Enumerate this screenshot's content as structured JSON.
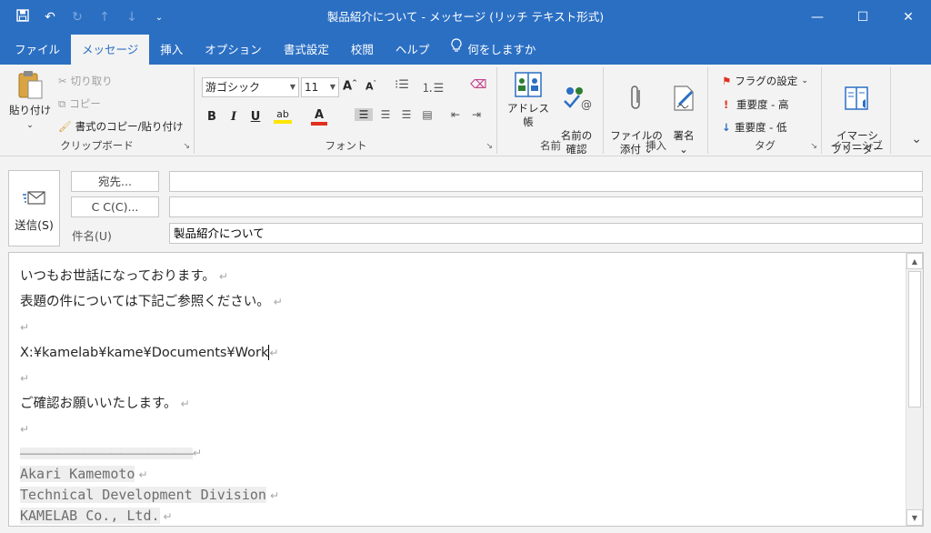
{
  "window": {
    "title": "製品紹介について - メッセージ (リッチ テキスト形式)",
    "qat_icons": [
      "save-icon",
      "undo-icon",
      "redo-icon",
      "up-arrow-icon",
      "down-arrow-icon",
      "customize-qat-icon"
    ],
    "controls": {
      "minimize": "—",
      "maximize": "☐",
      "close": "✕"
    }
  },
  "tabs": [
    "ファイル",
    "メッセージ",
    "挿入",
    "オプション",
    "書式設定",
    "校閲",
    "ヘルプ"
  ],
  "active_tab": "メッセージ",
  "tell_me": "何をしますか",
  "ribbon": {
    "clipboard": {
      "paste": "貼り付け",
      "cut": "切り取り",
      "copy": "コピー",
      "format_painter": "書式のコピー/貼り付け",
      "label": "クリップボード"
    },
    "font": {
      "font_name": "游ゴシック",
      "font_size": "11",
      "grow": "A",
      "shrink": "A",
      "bold": "B",
      "italic": "I",
      "underline": "U",
      "color_a": "A",
      "label": "フォント"
    },
    "names": {
      "address_book": "アドレス帳",
      "check_names": "名前の\n確認",
      "label": "名前"
    },
    "include": {
      "attach": "ファイルの\n添付 ⌄",
      "signature": "署名\n⌄",
      "label": "挿入"
    },
    "tags": {
      "follow_up": "フラグの設定",
      "high": "重要度 - 高",
      "low": "重要度 - 低",
      "label": "タグ"
    },
    "immersive": {
      "reader": "イマーシ\nブリーダー",
      "label": "イマーシブ"
    }
  },
  "header": {
    "send": "送信(S)",
    "to_button": "宛先...",
    "cc_button": "C C(C)...",
    "subject_label": "件名(U)",
    "to_value": "",
    "cc_value": "",
    "subject_value": "製品紹介について"
  },
  "body": {
    "lines": [
      "いつもお世話になっております。",
      "表題の件については下記ご参照ください。",
      "",
      "X:¥kamelab¥kame¥Documents¥Work",
      "",
      "ご確認お願いいたします。",
      ""
    ],
    "separator": "―――――――――――――――――――",
    "signature": [
      "Akari Kamemoto",
      "Technical Development Division",
      "KAMELAB Co., Ltd."
    ],
    "para_mark": "↵"
  },
  "colors": {
    "accent": "#2b6fc3",
    "ribbon_bg": "#f3f3f3",
    "flag_red": "#e0301e",
    "low_blue": "#2b6fc3"
  }
}
